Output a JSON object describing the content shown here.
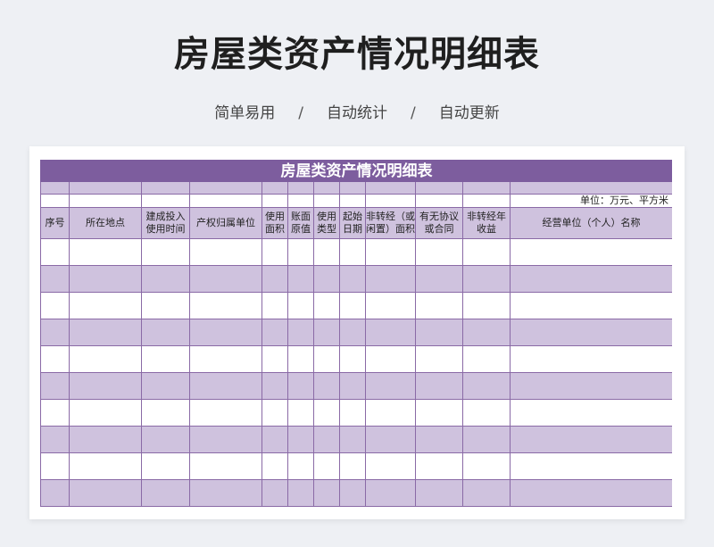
{
  "page": {
    "title": "房屋类资产情况明细表",
    "tags": [
      "简单易用",
      "自动统计",
      "自动更新"
    ],
    "separator": "/"
  },
  "sheet": {
    "title": "房屋类资产情况明细表",
    "unit": "单位：万元、平方米",
    "headers": [
      "序号",
      "所在地点",
      "建成投入使用时间",
      "产权归属单位",
      "使用面积",
      "账面原值",
      "使用类型",
      "起始日期",
      "非转经（或闲置）面积",
      "有无协议或合同",
      "非转经年收益",
      "经营单位（个人）名称"
    ],
    "rows": [
      [
        "",
        "",
        "",
        "",
        "",
        "",
        "",
        "",
        "",
        "",
        "",
        ""
      ],
      [
        "",
        "",
        "",
        "",
        "",
        "",
        "",
        "",
        "",
        "",
        "",
        ""
      ],
      [
        "",
        "",
        "",
        "",
        "",
        "",
        "",
        "",
        "",
        "",
        "",
        ""
      ],
      [
        "",
        "",
        "",
        "",
        "",
        "",
        "",
        "",
        "",
        "",
        "",
        ""
      ],
      [
        "",
        "",
        "",
        "",
        "",
        "",
        "",
        "",
        "",
        "",
        "",
        ""
      ],
      [
        "",
        "",
        "",
        "",
        "",
        "",
        "",
        "",
        "",
        "",
        "",
        ""
      ],
      [
        "",
        "",
        "",
        "",
        "",
        "",
        "",
        "",
        "",
        "",
        "",
        ""
      ],
      [
        "",
        "",
        "",
        "",
        "",
        "",
        "",
        "",
        "",
        "",
        "",
        ""
      ],
      [
        "",
        "",
        "",
        "",
        "",
        "",
        "",
        "",
        "",
        "",
        "",
        ""
      ],
      [
        "",
        "",
        "",
        "",
        "",
        "",
        "",
        "",
        "",
        "",
        "",
        ""
      ]
    ],
    "colors": {
      "title_bg": "#7d5d9e",
      "band": "#cfc2de",
      "border": "#8a6aa6"
    }
  }
}
